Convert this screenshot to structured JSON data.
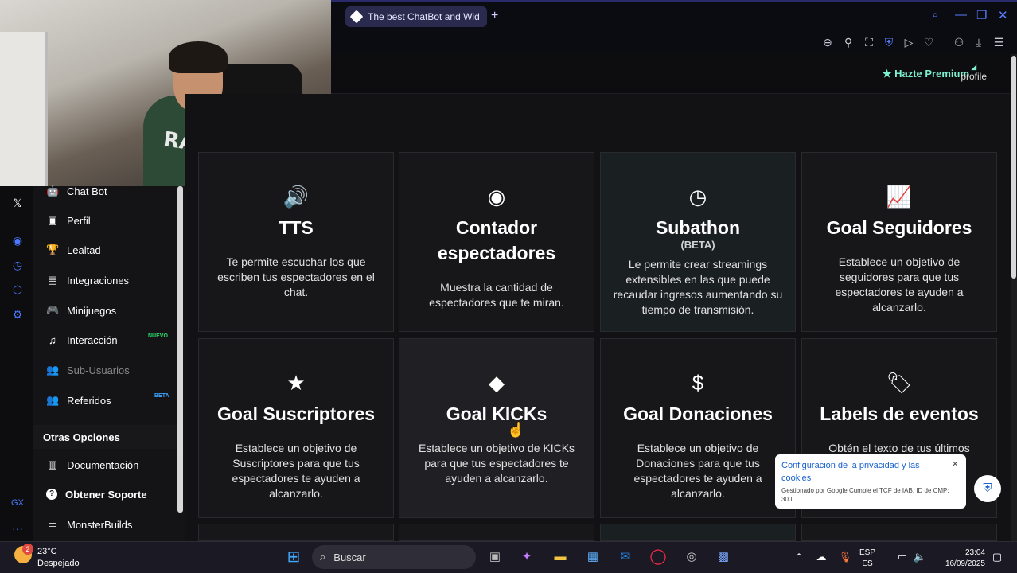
{
  "browser": {
    "tab_title": "The best ChatBot and Wid",
    "new_tab": "+"
  },
  "site_header": {
    "premium_label": "Hazte Premium",
    "profile_label": "profile"
  },
  "sidebar": {
    "items": [
      {
        "label": "Chat Bot",
        "icon": "robot-icon",
        "glyph": "🤖"
      },
      {
        "label": "Perfil",
        "icon": "id-card-icon",
        "glyph": "▣"
      },
      {
        "label": "Lealtad",
        "icon": "trophy-icon",
        "glyph": "🏆"
      },
      {
        "label": "Integraciones",
        "icon": "plug-icon",
        "glyph": "▤"
      },
      {
        "label": "Minijuegos",
        "icon": "gamepad-icon",
        "glyph": "🎮"
      },
      {
        "label": "Interacción",
        "icon": "music-icon",
        "glyph": "♫",
        "badge": "NUEVO",
        "badge_color": "#2bd66b"
      },
      {
        "label": "Sub-Usuarios",
        "icon": "users-icon",
        "glyph": "👥"
      },
      {
        "label": "Referidos",
        "icon": "user-group-icon",
        "glyph": "👥",
        "badge": "BETA",
        "badge_color": "#3ba7ff"
      }
    ],
    "section_title": "Otras Opciones",
    "other_items": [
      {
        "label": "Documentación",
        "icon": "book-icon",
        "glyph": "▥"
      },
      {
        "label": "Obtener Soporte",
        "icon": "help-icon",
        "glyph": "?"
      },
      {
        "label": "MonsterBuilds",
        "icon": "laptop-icon",
        "glyph": "▭"
      }
    ]
  },
  "cards": [
    {
      "title": "TTS",
      "subtitle": "",
      "description": "Te permite escuchar los que escriben tus espectadores en el chat.",
      "icon": "volume-icon",
      "glyph": "🔊"
    },
    {
      "title": "Contador espectadores",
      "subtitle": "",
      "description": "Muestra la cantidad de espectadores que te miran.",
      "icon": "eye-icon",
      "glyph": "◉"
    },
    {
      "title": "Subathon",
      "subtitle": "(BETA)",
      "description": "Le permite crear streamings extensibles en las que puede recaudar ingresos aumentando su tiempo de transmisión.",
      "icon": "clock-icon",
      "glyph": "◷"
    },
    {
      "title": "Goal Seguidores",
      "subtitle": "",
      "description": "Establece un objetivo de seguidores para que tus espectadores te ayuden a alcanzarlo.",
      "icon": "chart-line-icon",
      "glyph": "📈"
    },
    {
      "title": "Goal Suscriptores",
      "subtitle": "",
      "description": "Establece un objetivo de Suscriptores para que tus espectadores te ayuden a alcanzarlo.",
      "icon": "star-icon",
      "glyph": "★"
    },
    {
      "title": "Goal KICKs",
      "subtitle": "",
      "description": "Establece un objetivo de KICKs para que tus espectadores te ayuden a alcanzarlo.",
      "icon": "gem-icon",
      "glyph": "◆"
    },
    {
      "title": "Goal Donaciones",
      "subtitle": "",
      "description": "Establece un objetivo de Donaciones para que tus espectadores te ayuden a alcanzarlo.",
      "icon": "dollar-icon",
      "glyph": "$"
    },
    {
      "title": "Labels de eventos",
      "subtitle": "",
      "description": "Obtén el texto de tus últimos",
      "icon": "tags-icon",
      "glyph": "🏷"
    }
  ],
  "cookie_popup": {
    "title": "Configuración de la privacidad y las cookies",
    "subtitle": "Gestionado por Google Cumple el TCF de IAB. ID de CMP: 300",
    "close": "×"
  },
  "taskbar": {
    "weather_temp": "23°C",
    "weather_desc": "Despejado",
    "notification_count": "2",
    "search_placeholder": "Buscar",
    "language": "ESP",
    "language_sub": "ES",
    "time": "23:04",
    "date": "16/09/2025"
  }
}
